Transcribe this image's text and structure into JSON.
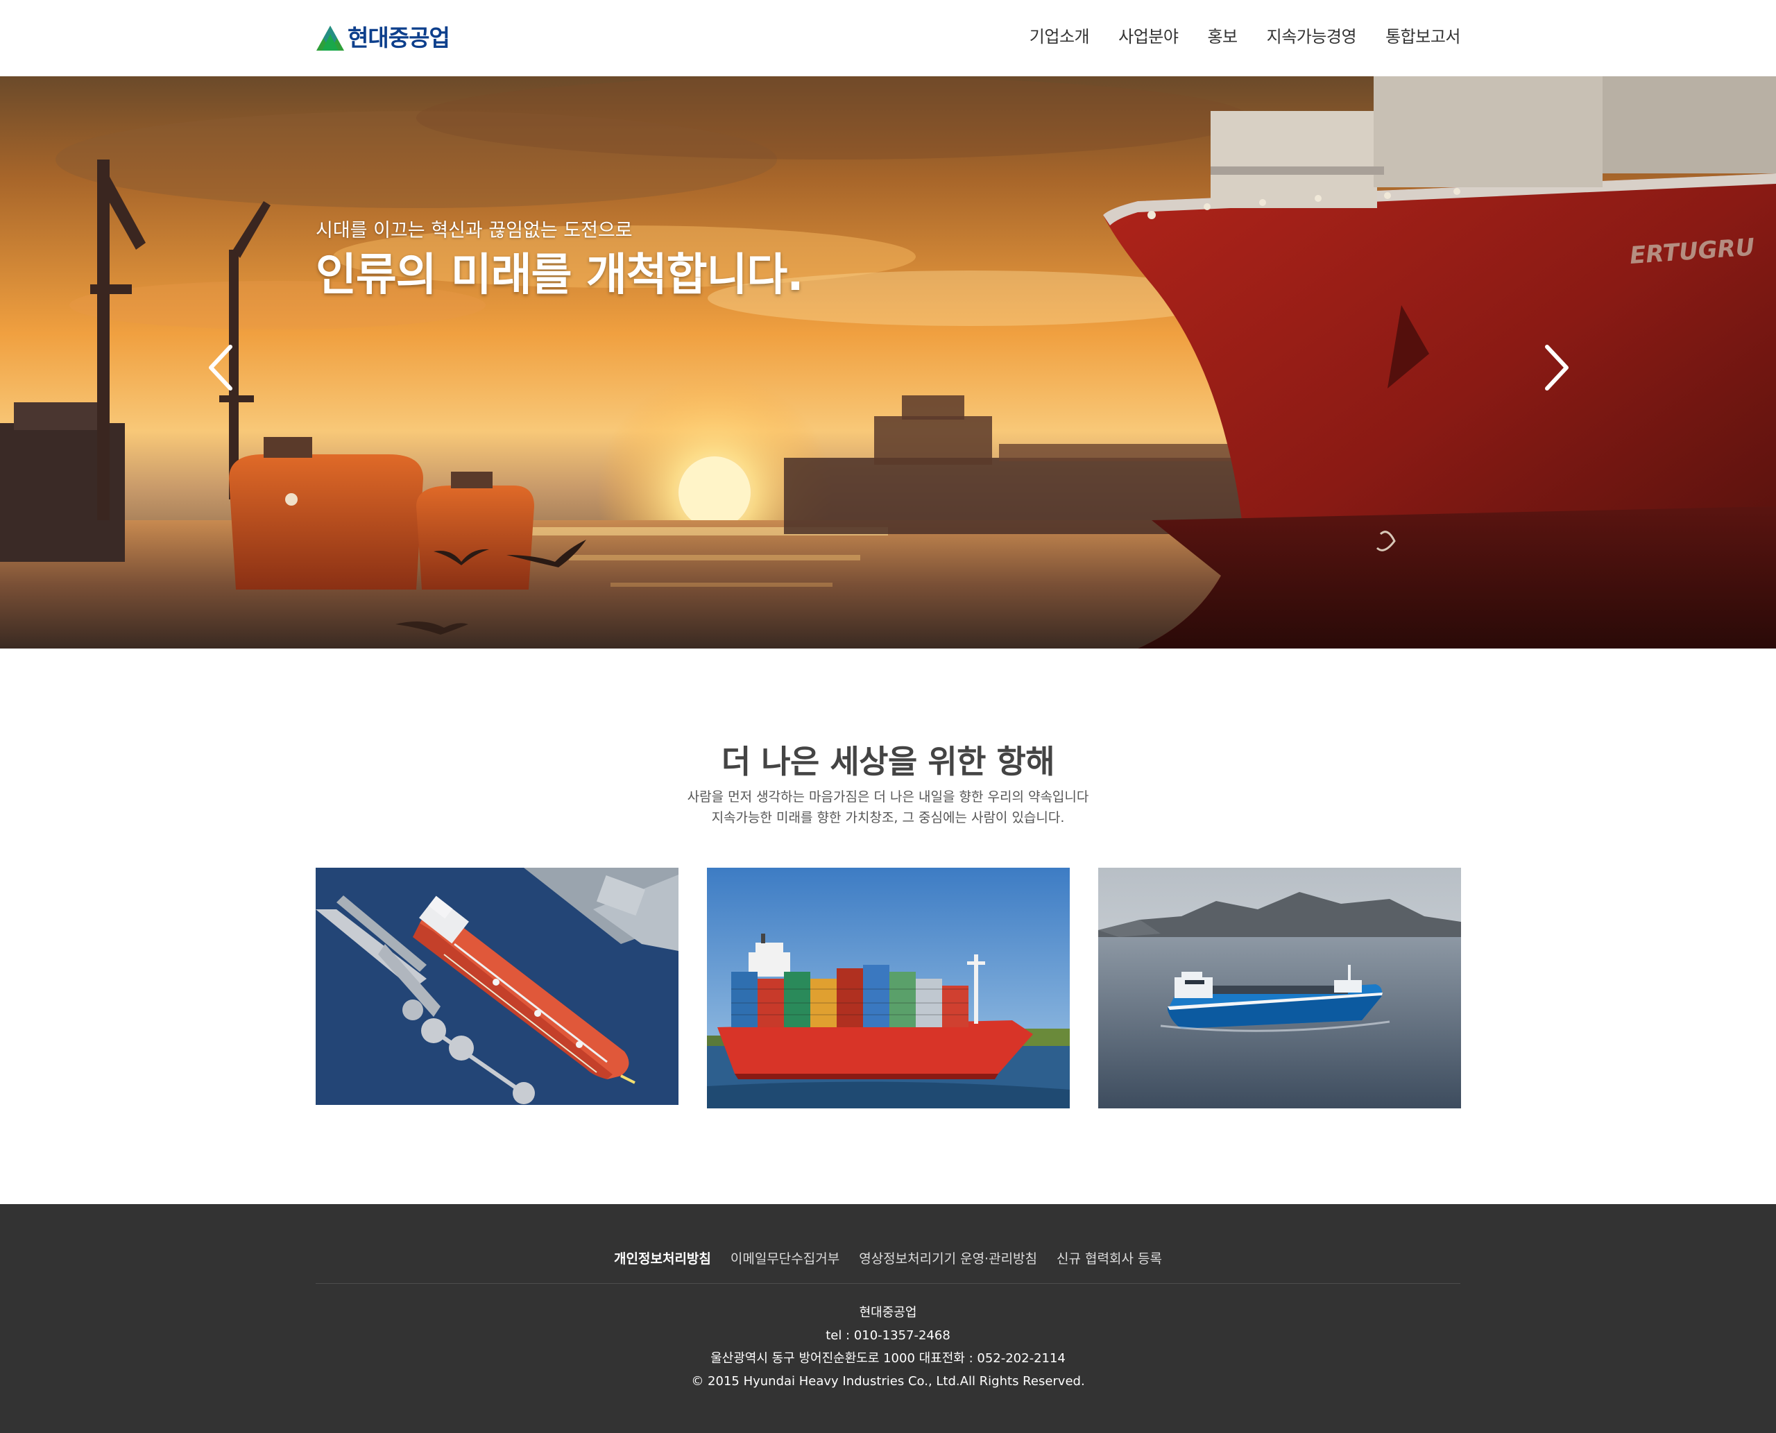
{
  "header": {
    "logo_text": "현대중공업",
    "nav": [
      "기업소개",
      "사업분야",
      "홍보",
      "지속가능경영",
      "통합보고서"
    ]
  },
  "hero": {
    "subtitle": "시대를 이끄는 혁신과 끊임없는 도전으로",
    "title": "인류의 미래를 개척합니다.",
    "ship_name": "ERTUGRU"
  },
  "section": {
    "title": "더 나은 세상을 위한 항해",
    "desc_line1": "사람을 먼저 생각하는 마음가짐은 더 나은 내일을 향한 우리의 약속입니다",
    "desc_line2": "지속가능한 미래를 향한 가치창조, 그 중심에는 사람이 있습니다."
  },
  "cards": [
    {
      "icon": "tanker-ship-image"
    },
    {
      "icon": "container-ship-image"
    },
    {
      "icon": "autonomous-ship-image"
    }
  ],
  "footer": {
    "links": [
      "개인정보처리방침",
      "이메일무단수집거부",
      "영상정보처리기기 운영·관리방침",
      "신규 협력회사 등록"
    ],
    "company": "현대중공업",
    "tel": "tel : 010-1357-2468",
    "address": "울산광역시 동구 방어진순환도로 1000 대표전화 : 052-202-2114",
    "copyright": "© 2015 Hyundai Heavy Industries Co., Ltd.All Rights Reserved."
  },
  "colors": {
    "brand_blue": "#0d3f8c",
    "brand_green": "#2e9f3a",
    "footer_bg": "#333333",
    "heading": "#444444"
  }
}
